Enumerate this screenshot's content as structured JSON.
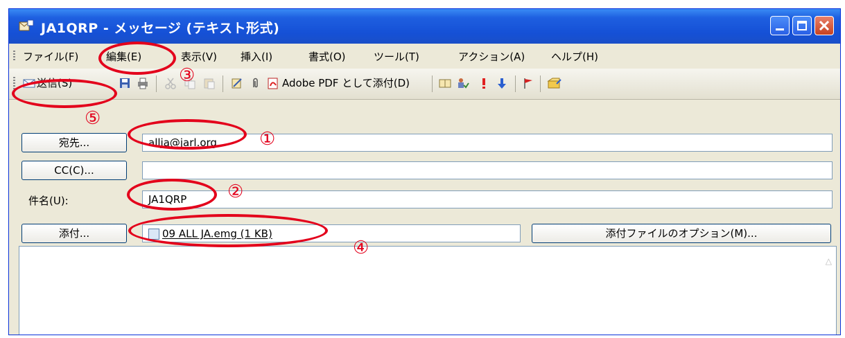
{
  "window": {
    "title": "JA1QRP - メッセージ (テキスト形式)"
  },
  "menu": {
    "items": [
      {
        "label": "ファイル(F)"
      },
      {
        "label": "編集(E)"
      },
      {
        "label": "表示(V)"
      },
      {
        "label": "挿入(I)"
      },
      {
        "label": "書式(O)"
      },
      {
        "label": "ツール(T)"
      },
      {
        "label": "アクション(A)"
      },
      {
        "label": "ヘルプ(H)"
      }
    ]
  },
  "toolbar": {
    "send_label": "送信(S)",
    "pdf_label": "Adobe PDF として添付(D)"
  },
  "form": {
    "to_button": "宛先...",
    "to_value": "allja@jarl.org",
    "cc_button": "CC(C)...",
    "cc_value": "",
    "subject_label": "件名(U):",
    "subject_value": "JA1QRP",
    "attach_button": "添付...",
    "attach_value": "09 ALL JA.emg (1 KB)",
    "attach_options_button": "添付ファイルのオプション(M)..."
  },
  "annotations": {
    "n1": "①",
    "n2": "②",
    "n3": "③",
    "n4": "④",
    "n5": "⑤"
  },
  "colors": {
    "titlebar": "#1e5fe0",
    "annotation": "#e3001b",
    "background": "#ece9d8"
  }
}
